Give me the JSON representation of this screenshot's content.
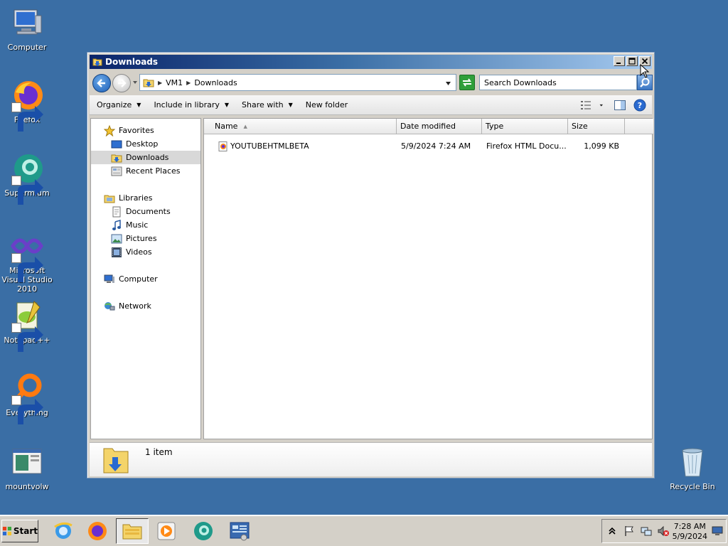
{
  "desktop": {
    "icons": [
      {
        "label": "Computer"
      },
      {
        "label": "Firefox"
      },
      {
        "label": "Supermium"
      },
      {
        "label": "Microsoft Visual Studio 2010"
      },
      {
        "label": "Notepad++"
      },
      {
        "label": "Everything"
      },
      {
        "label": "mountvolw"
      },
      {
        "label": "Recycle Bin"
      }
    ]
  },
  "window": {
    "title": "Downloads",
    "address": {
      "crumbs": [
        "VM1",
        "Downloads"
      ]
    },
    "search_placeholder": "Search Downloads",
    "toolbar": {
      "organize": "Organize",
      "include_in_library": "Include in library",
      "share_with": "Share with",
      "new_folder": "New folder"
    },
    "nav": {
      "favorites": "Favorites",
      "desktop": "Desktop",
      "downloads": "Downloads",
      "recent_places": "Recent Places",
      "libraries": "Libraries",
      "documents": "Documents",
      "music": "Music",
      "pictures": "Pictures",
      "videos": "Videos",
      "computer": "Computer",
      "network": "Network"
    },
    "columns": {
      "name": "Name",
      "date_modified": "Date modified",
      "type": "Type",
      "size": "Size"
    },
    "files": [
      {
        "name": "YOUTUBEHTMLBETA",
        "date_modified": "5/9/2024 7:24 AM",
        "type": "Firefox HTML Docu...",
        "size": "1,099 KB"
      }
    ],
    "details": {
      "count": "1 item"
    }
  },
  "taskbar": {
    "start_label": "Start",
    "clock_time": "7:28 AM",
    "clock_date": "5/9/2024"
  },
  "colors": {
    "desktop_bg": "#3a6ea5",
    "title_bar_start": "#0a246a",
    "title_bar_end": "#a6caf0"
  }
}
